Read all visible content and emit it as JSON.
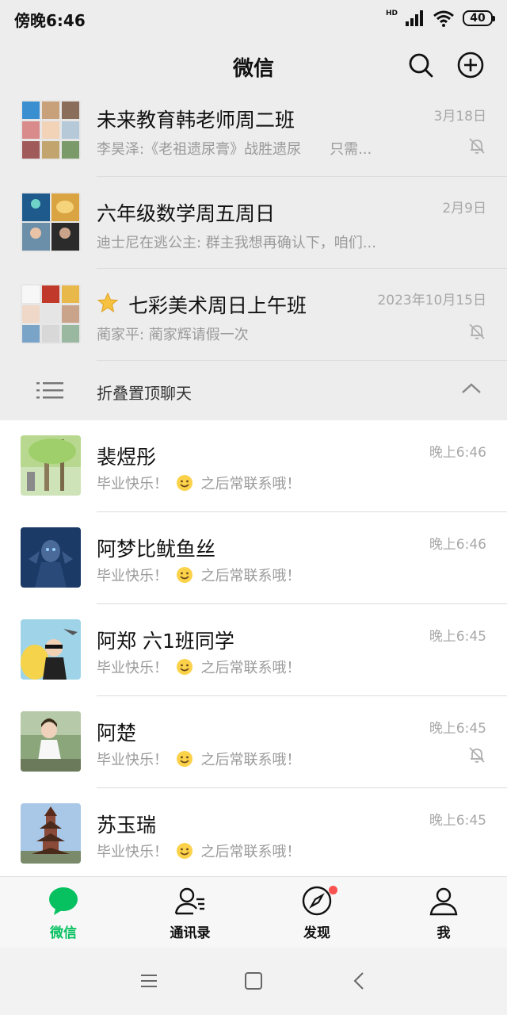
{
  "status_bar": {
    "time": "傍晚6:46",
    "network": "HD",
    "battery": "40"
  },
  "header": {
    "title": "微信"
  },
  "pinned_chats": [
    {
      "name": "未来教育韩老师周二班",
      "message": "李昊泽:《老祖遗尿膏》战胜遗尿　　只需...",
      "time": "3月18日",
      "muted": true,
      "starred": false
    },
    {
      "name": "六年级数学周五周日",
      "message": "迪士尼在逃公主: 群主我想再确认下，咱们...",
      "time": "2月9日",
      "muted": false,
      "starred": false
    },
    {
      "name": "七彩美术周日上午班",
      "message": "蔺家平: 蔺家辉请假一次",
      "time": "2023年10月15日",
      "muted": true,
      "starred": true
    }
  ],
  "fold": {
    "label": "折叠置顶聊天"
  },
  "chats": [
    {
      "name": "裴煜彤",
      "message_prefix": "毕业快乐！",
      "message_suffix": "之后常联系哦！",
      "time": "晚上6:46",
      "muted": false
    },
    {
      "name": "阿梦比鱿鱼丝",
      "message_prefix": "毕业快乐！",
      "message_suffix": "之后常联系哦！",
      "time": "晚上6:46",
      "muted": false
    },
    {
      "name": "阿郑 六1班同学",
      "message_prefix": "毕业快乐！",
      "message_suffix": "之后常联系哦！",
      "time": "晚上6:45",
      "muted": false
    },
    {
      "name": "阿楚",
      "message_prefix": "毕业快乐！",
      "message_suffix": "之后常联系哦！",
      "time": "晚上6:45",
      "muted": true
    },
    {
      "name": "苏玉瑞",
      "message_prefix": "毕业快乐！",
      "message_suffix": "之后常联系哦！",
      "time": "晚上6:45",
      "muted": false
    }
  ],
  "tabs": [
    {
      "label": "微信",
      "icon": "chat-bubble-icon",
      "active": true
    },
    {
      "label": "通讯录",
      "icon": "contacts-icon",
      "active": false
    },
    {
      "label": "发现",
      "icon": "compass-icon",
      "active": false,
      "badge": true
    },
    {
      "label": "我",
      "icon": "person-icon",
      "active": false
    }
  ],
  "colors": {
    "accent": "#07c160",
    "badge": "#fa5151",
    "muted_text": "#9a9a9a",
    "background": "#ededed"
  }
}
